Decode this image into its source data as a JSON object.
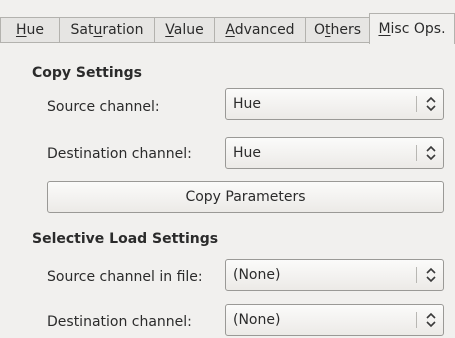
{
  "tabs": [
    {
      "label": "Hue",
      "mnemonic_prefix": "",
      "mnemonic": "H",
      "rest": "ue",
      "active": false
    },
    {
      "label": "Saturation",
      "mnemonic_prefix": "Sat",
      "mnemonic": "u",
      "rest": "ration",
      "active": false
    },
    {
      "label": "Value",
      "mnemonic_prefix": "",
      "mnemonic": "V",
      "rest": "alue",
      "active": false
    },
    {
      "label": "Advanced",
      "mnemonic_prefix": "",
      "mnemonic": "A",
      "rest": "dvanced",
      "active": false
    },
    {
      "label": "Others",
      "mnemonic_prefix": "O",
      "mnemonic": "t",
      "rest": "hers",
      "active": false
    },
    {
      "label": "Misc Ops.",
      "mnemonic_prefix": "",
      "mnemonic": "M",
      "rest": "isc Ops.",
      "active": true
    }
  ],
  "copy_settings": {
    "title": "Copy Settings",
    "source_label": "Source channel:",
    "source_value": "Hue",
    "destination_label": "Destination channel:",
    "destination_value": "Hue",
    "copy_button_label": "Copy Parameters"
  },
  "selective_load": {
    "title": "Selective Load Settings",
    "source_label": "Source channel in file:",
    "source_value": "(None)",
    "destination_label": "Destination channel:",
    "destination_value": "(None)"
  },
  "icons": {
    "combo_arrow": "up-down-chevron-icon"
  }
}
